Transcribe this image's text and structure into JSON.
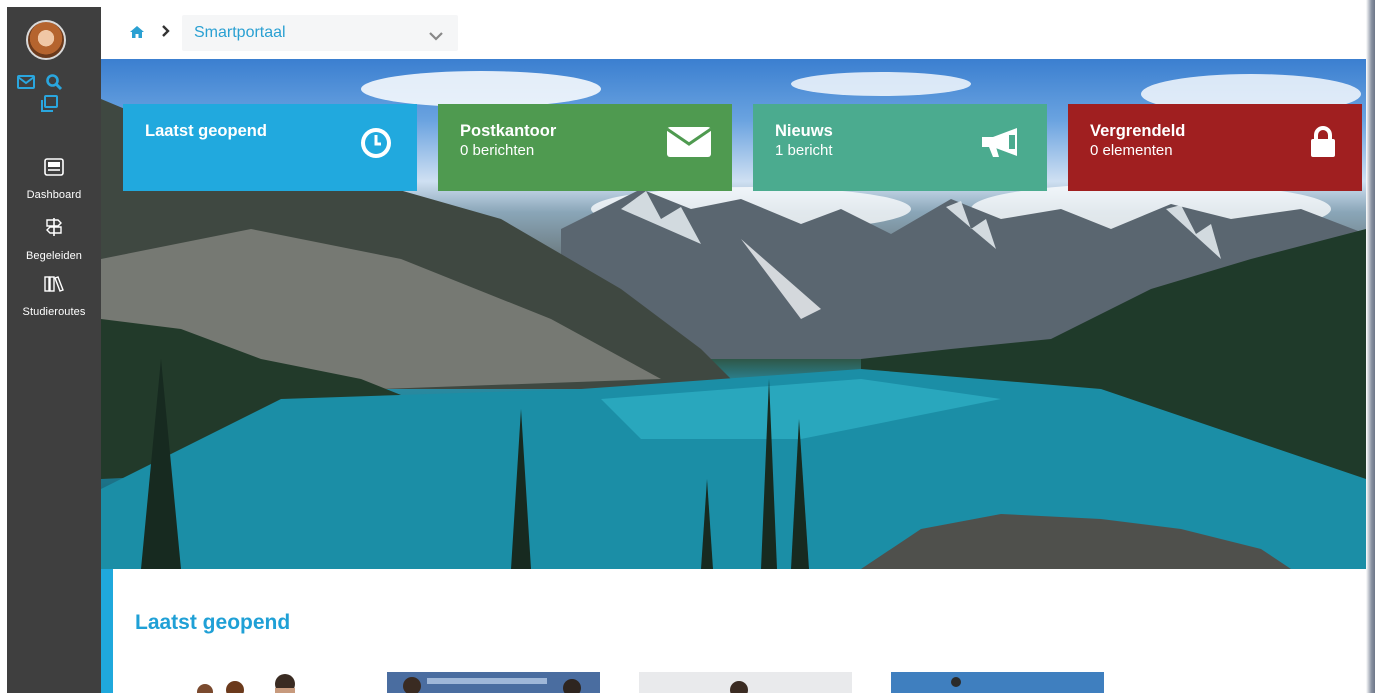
{
  "sidebar": {
    "items": [
      {
        "label": "Dashboard",
        "icon": "keyboard-icon"
      },
      {
        "label": "Begeleiden",
        "icon": "signpost-icon"
      },
      {
        "label": "Studieroutes",
        "icon": "books-icon"
      }
    ],
    "icons": [
      "mail-icon",
      "search-icon",
      "windows-icon"
    ]
  },
  "breadcrumb": {
    "current": "Smartportaal"
  },
  "tiles": [
    {
      "title": "Laatst geopend",
      "subtitle": "",
      "icon": "clock-icon",
      "color": "#21a9de"
    },
    {
      "title": "Postkantoor",
      "subtitle": "0 berichten",
      "icon": "envelope-icon",
      "color": "#4f9a50"
    },
    {
      "title": "Nieuws",
      "subtitle": "1 bericht",
      "icon": "megaphone-icon",
      "color": "#4bab8f"
    },
    {
      "title": "Vergrendeld",
      "subtitle": "0 elementen",
      "icon": "lock-icon",
      "color": "#a01f20"
    }
  ],
  "section": {
    "title": "Laatst geopend"
  },
  "colors": {
    "accent": "#1fa8dc",
    "sidebar": "#3f3f3f",
    "link": "#2aa0d2"
  }
}
